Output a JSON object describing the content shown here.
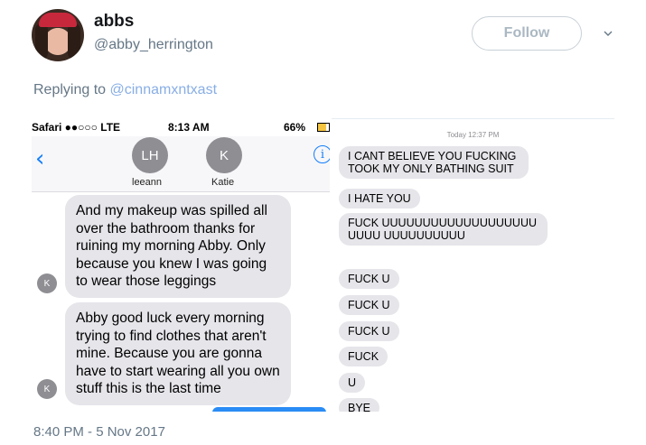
{
  "tweet": {
    "display_name": "abbs",
    "handle": "@abby_herrington",
    "follow_label": "Follow",
    "reply_prefix": "Replying to",
    "reply_mention": "@cinnamxntxast",
    "timestamp": "8:40 PM - 5 Nov 2017"
  },
  "left_screenshot": {
    "status": {
      "carrier": "Safari ●●○○○ LTE",
      "time": "8:13 AM",
      "battery": "66%"
    },
    "contacts": [
      {
        "initials": "LH",
        "name": "leeann"
      },
      {
        "initials": "K",
        "name": "Katie"
      }
    ],
    "messages": [
      {
        "sender_initial": "K",
        "text": "And my makeup was spilled all over the bathroom thanks for ruining my morning Abby. Only because you knew I was going to wear those leggings"
      },
      {
        "sender_initial": "K",
        "text": "Abby good luck every morning trying to find clothes that aren't mine. Because you are gonna have to start wearing all you own stuff this is the last time"
      }
    ]
  },
  "right_screenshot": {
    "time_label": "Today 12:37 PM",
    "messages": [
      "I CANT BELIEVE YOU FUCKING TOOK MY ONLY BATHING SUIT",
      "I HATE YOU",
      "FUCK UUUUUUUUUUUUUUUUUUUUUUU UUUUUUUUUU",
      "FUCK U",
      "FUCK U",
      "FUCK U",
      "FUCK",
      "U",
      "BYE"
    ]
  }
}
